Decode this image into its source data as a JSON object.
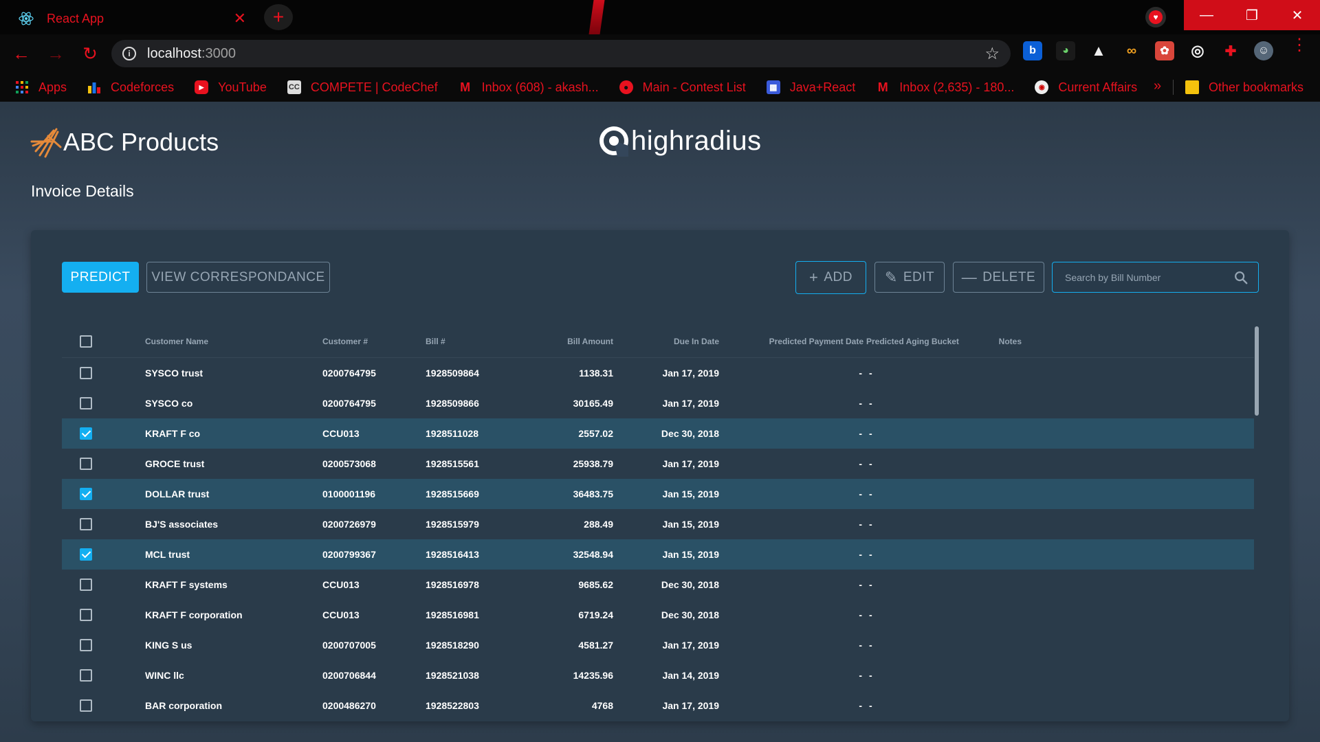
{
  "browser": {
    "tab_title": "React App",
    "tab_close": "✕",
    "new_tab": "+",
    "url_host": "localhost",
    "url_port": ":3000",
    "window_controls": [
      "—",
      "❐",
      "✕"
    ],
    "bookmarks": [
      {
        "label": "Apps",
        "icon": "apps-grid-icon"
      },
      {
        "label": "Codeforces",
        "icon": "codeforces-icon"
      },
      {
        "label": "YouTube",
        "icon": "youtube-icon"
      },
      {
        "label": "COMPETE | CodeChef",
        "icon": "codechef-icon"
      },
      {
        "label": "Inbox (608) - akash...",
        "icon": "gmail-icon"
      },
      {
        "label": "Main - Contest List",
        "icon": "contest-icon"
      },
      {
        "label": "Java+React",
        "icon": "page-icon"
      },
      {
        "label": "Inbox (2,635) - 180...",
        "icon": "gmail-icon"
      },
      {
        "label": "Current Affairs",
        "icon": "news-icon"
      }
    ],
    "bookmarks_more": "»",
    "other_bookmarks": "Other bookmarks",
    "accent": "#e8121f"
  },
  "app": {
    "brand_name": "ABC Products",
    "partner_name": "highradius",
    "page_title": "Invoice Details",
    "buttons": {
      "predict": "PREDICT",
      "view_correspondance": "VIEW CORRESPONDANCE",
      "add": "ADD",
      "edit": "EDIT",
      "delete": "DELETE"
    },
    "search": {
      "placeholder": "Search by Bill Number",
      "value": ""
    },
    "colors": {
      "primary": "#14aff1",
      "panel": "#2a3b4a",
      "selected_row": "#2a5166"
    }
  },
  "table": {
    "columns": {
      "customer_name": "Customer Name",
      "customer_no": "Customer #",
      "bill_no": "Bill #",
      "bill_amount": "Bill Amount",
      "due_date": "Due In Date",
      "predicted_date": "Predicted Payment Date",
      "aging_bucket": "Predicted Aging Bucket",
      "notes": "Notes"
    },
    "rows": [
      {
        "selected": false,
        "name": "SYSCO trust",
        "custno": "0200764795",
        "bill": "1928509864",
        "amount": "1138.31",
        "due": "Jan 17, 2019",
        "pred": "-",
        "aging": "-",
        "notes": ""
      },
      {
        "selected": false,
        "name": "SYSCO co",
        "custno": "0200764795",
        "bill": "1928509866",
        "amount": "30165.49",
        "due": "Jan 17, 2019",
        "pred": "-",
        "aging": "-",
        "notes": ""
      },
      {
        "selected": true,
        "name": "KRAFT F co",
        "custno": "CCU013",
        "bill": "1928511028",
        "amount": "2557.02",
        "due": "Dec 30, 2018",
        "pred": "-",
        "aging": "-",
        "notes": ""
      },
      {
        "selected": false,
        "name": "GROCE trust",
        "custno": "0200573068",
        "bill": "1928515561",
        "amount": "25938.79",
        "due": "Jan 17, 2019",
        "pred": "-",
        "aging": "-",
        "notes": ""
      },
      {
        "selected": true,
        "name": "DOLLAR trust",
        "custno": "0100001196",
        "bill": "1928515669",
        "amount": "36483.75",
        "due": "Jan 15, 2019",
        "pred": "-",
        "aging": "-",
        "notes": ""
      },
      {
        "selected": false,
        "name": "BJ'S associates",
        "custno": "0200726979",
        "bill": "1928515979",
        "amount": "288.49",
        "due": "Jan 15, 2019",
        "pred": "-",
        "aging": "-",
        "notes": ""
      },
      {
        "selected": true,
        "name": "MCL trust",
        "custno": "0200799367",
        "bill": "1928516413",
        "amount": "32548.94",
        "due": "Jan 15, 2019",
        "pred": "-",
        "aging": "-",
        "notes": ""
      },
      {
        "selected": false,
        "name": "KRAFT F systems",
        "custno": "CCU013",
        "bill": "1928516978",
        "amount": "9685.62",
        "due": "Dec 30, 2018",
        "pred": "-",
        "aging": "-",
        "notes": ""
      },
      {
        "selected": false,
        "name": "KRAFT F corporation",
        "custno": "CCU013",
        "bill": "1928516981",
        "amount": "6719.24",
        "due": "Dec 30, 2018",
        "pred": "-",
        "aging": "-",
        "notes": ""
      },
      {
        "selected": false,
        "name": "KING S us",
        "custno": "0200707005",
        "bill": "1928518290",
        "amount": "4581.27",
        "due": "Jan 17, 2019",
        "pred": "-",
        "aging": "-",
        "notes": ""
      },
      {
        "selected": false,
        "name": "WINC llc",
        "custno": "0200706844",
        "bill": "1928521038",
        "amount": "14235.96",
        "due": "Jan 14, 2019",
        "pred": "-",
        "aging": "-",
        "notes": ""
      },
      {
        "selected": false,
        "name": "BAR corporation",
        "custno": "0200486270",
        "bill": "1928522803",
        "amount": "4768",
        "due": "Jan 17, 2019",
        "pred": "-",
        "aging": "-",
        "notes": ""
      }
    ]
  }
}
